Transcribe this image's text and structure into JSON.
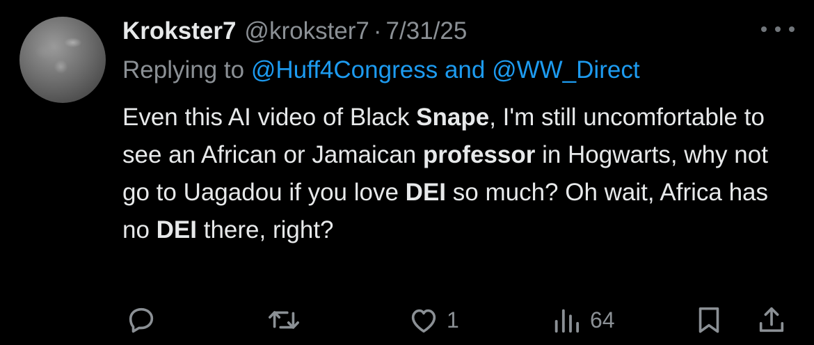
{
  "tweet": {
    "display_name": "Krokster7",
    "handle": "@krokster7",
    "separator": "·",
    "date": "7/31/25",
    "avatar_icon": "avatar-photo",
    "more_icon": "more-dots-icon",
    "reply_to": {
      "prefix": "Replying to",
      "mention_1": "@Huff4Congress",
      "joiner": "and",
      "mention_2": "@WW_Direct"
    },
    "body": {
      "s1": "Even this AI video of Black ",
      "b1": "Snape",
      "s2": ", I'm still uncomfortable to see an African or Jamaican ",
      "b2": "professor",
      "s3": " in Hogwarts, why not go to Uagadou if you love ",
      "b3": "DEI",
      "s4": " so much? Oh wait, Africa has no ",
      "b4": "DEI",
      "s5": " there, right?"
    },
    "actions": {
      "reply_icon": "reply-icon",
      "repost_icon": "repost-icon",
      "like_icon": "heart-icon",
      "like_count": "1",
      "views_icon": "views-bar-icon",
      "views_count": "64",
      "bookmark_icon": "bookmark-icon",
      "share_icon": "share-icon"
    }
  },
  "colors": {
    "background": "#000000",
    "text_primary": "#e7e9ea",
    "text_secondary": "#8b9095",
    "accent": "#1d9bf0"
  }
}
